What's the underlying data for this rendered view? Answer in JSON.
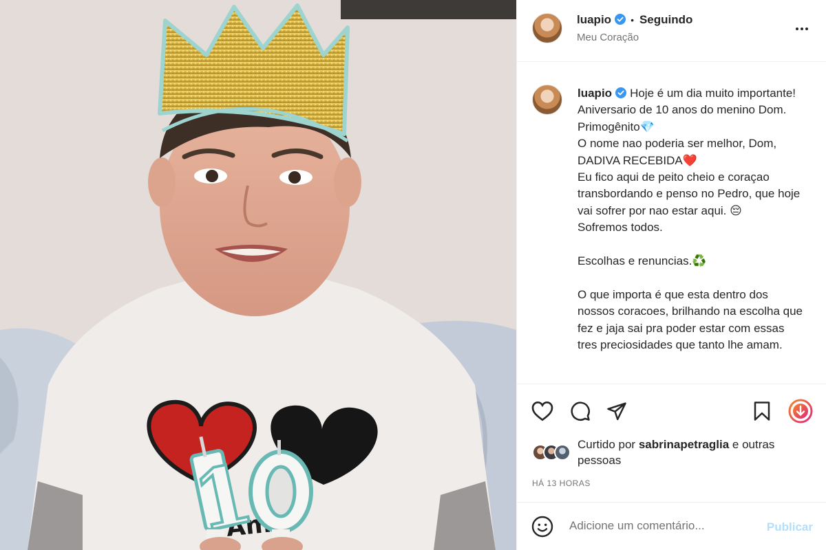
{
  "post": {
    "photo_alt": "",
    "candle_digits": "10"
  },
  "header": {
    "username": "luapio",
    "separator": "•",
    "follow_status": "Seguindo",
    "location": "Meu Coração",
    "more_icon": "more-horizontal-icon"
  },
  "caption": {
    "username": "luapio",
    "text": "Hoje é um dia muito importante! Aniversario de 10 anos do menino Dom. Primogênito💎\nO nome nao poderia ser melhor, Dom, DADIVA RECEBIDA❤️\nEu fico aqui de peito cheio e coraçao transbordando e penso no Pedro, que hoje vai sofrer por nao estar aqui. 😔\nSofremos todos.\n\nEscolhas e renuncias.♻️\n\nO que importa é que esta dentro dos nossos coracoes, brilhando na escolha que fez e jaja sai pra poder estar com essas tres preciosidades que tanto lhe amam."
  },
  "actions": {
    "icons": [
      "heart-icon",
      "comment-icon",
      "share-icon",
      "bookmark-icon",
      "download-icon"
    ],
    "liked_by_prefix": "Curtido por",
    "liked_by_user": "sabrinapetraglia",
    "liked_by_suffix": "e outras pessoas",
    "timestamp": "HÁ 13 HORAS"
  },
  "comment": {
    "placeholder": "Adicione um comentário...",
    "publish_label": "Publicar",
    "emoji_icon": "smiley-icon"
  },
  "colors": {
    "verified_blue": "#3897f0",
    "publish_disabled": "#b2dffc",
    "download_gradient_start": "#f58529",
    "download_gradient_end": "#dd2a7b"
  }
}
